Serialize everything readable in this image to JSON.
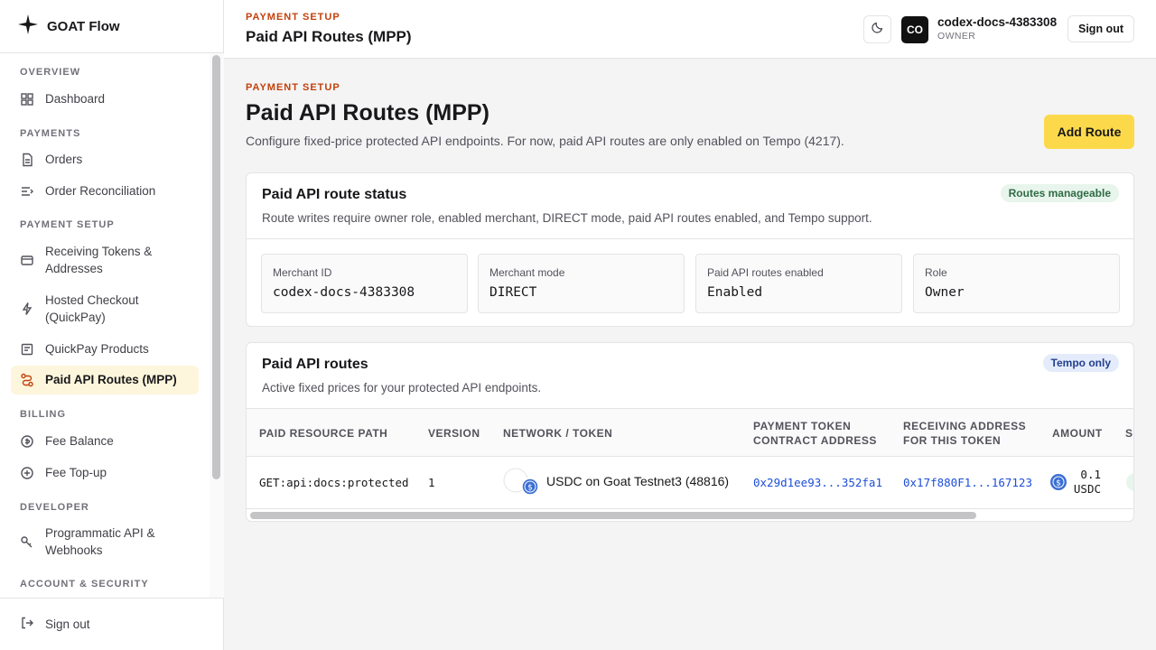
{
  "brand": {
    "name": "GOAT Flow"
  },
  "sidebar": {
    "sections": [
      {
        "title": "OVERVIEW"
      },
      {
        "title": "PAYMENTS"
      },
      {
        "title": "PAYMENT SETUP"
      },
      {
        "title": "BILLING"
      },
      {
        "title": "DEVELOPER"
      },
      {
        "title": "ACCOUNT & SECURITY"
      }
    ],
    "items": [
      {
        "label": "Dashboard",
        "icon": "grid-icon"
      },
      {
        "label": "Orders",
        "icon": "document-icon"
      },
      {
        "label": "Order Reconciliation",
        "icon": "reconcile-icon"
      },
      {
        "label": "Receiving Tokens & Addresses",
        "icon": "wallet-icon"
      },
      {
        "label": "Hosted Checkout (QuickPay)",
        "icon": "lightning-icon"
      },
      {
        "label": "QuickPay Products",
        "icon": "receipt-icon"
      },
      {
        "label": "Paid API Routes (MPP)",
        "icon": "route-icon",
        "active": true
      },
      {
        "label": "Fee Balance",
        "icon": "coin-icon"
      },
      {
        "label": "Fee Top-up",
        "icon": "plus-circle-icon"
      },
      {
        "label": "Programmatic API & Webhooks",
        "icon": "key-icon"
      }
    ],
    "footer": {
      "sign_out": "Sign out"
    }
  },
  "header": {
    "kicker": "PAYMENT SETUP",
    "title": "Paid API Routes (MPP)",
    "avatar_initials": "CO",
    "user_name": "codex-docs-4383308",
    "user_role": "OWNER",
    "sign_out": "Sign out"
  },
  "page": {
    "kicker": "PAYMENT SETUP",
    "title": "Paid API Routes (MPP)",
    "description": "Configure fixed-price protected API endpoints. For now, paid API routes are only enabled on Tempo (4217).",
    "add_button": "Add Route"
  },
  "status_card": {
    "title": "Paid API route status",
    "subtitle": "Route writes require owner role, enabled merchant, DIRECT mode, paid API routes enabled, and Tempo support.",
    "badge": "Routes manageable",
    "stats": [
      {
        "label": "Merchant ID",
        "value": "codex-docs-4383308"
      },
      {
        "label": "Merchant mode",
        "value": "DIRECT"
      },
      {
        "label": "Paid API routes enabled",
        "value": "Enabled"
      },
      {
        "label": "Role",
        "value": "Owner"
      }
    ]
  },
  "routes_card": {
    "title": "Paid API routes",
    "subtitle": "Active fixed prices for your protected API endpoints.",
    "badge": "Tempo only",
    "columns": [
      "PAID RESOURCE PATH",
      "VERSION",
      "NETWORK / TOKEN",
      "PAYMENT TOKEN CONTRACT ADDRESS",
      "RECEIVING ADDRESS FOR THIS TOKEN",
      "AMOUNT",
      "S"
    ],
    "rows": [
      {
        "path": "GET:api:docs:protected",
        "version": "1",
        "network_token": "USDC on Goat Testnet3 (48816)",
        "contract_address": "0x29d1ee93...352fa1",
        "receiving_address": "0x17f880F1...167123",
        "amount_value": "0.1",
        "amount_unit": "USDC"
      }
    ]
  },
  "colors": {
    "accent": "#fcd94a",
    "kicker": "#c2410c",
    "active_bg": "#fdf6dc",
    "link": "#1d4ed8"
  }
}
